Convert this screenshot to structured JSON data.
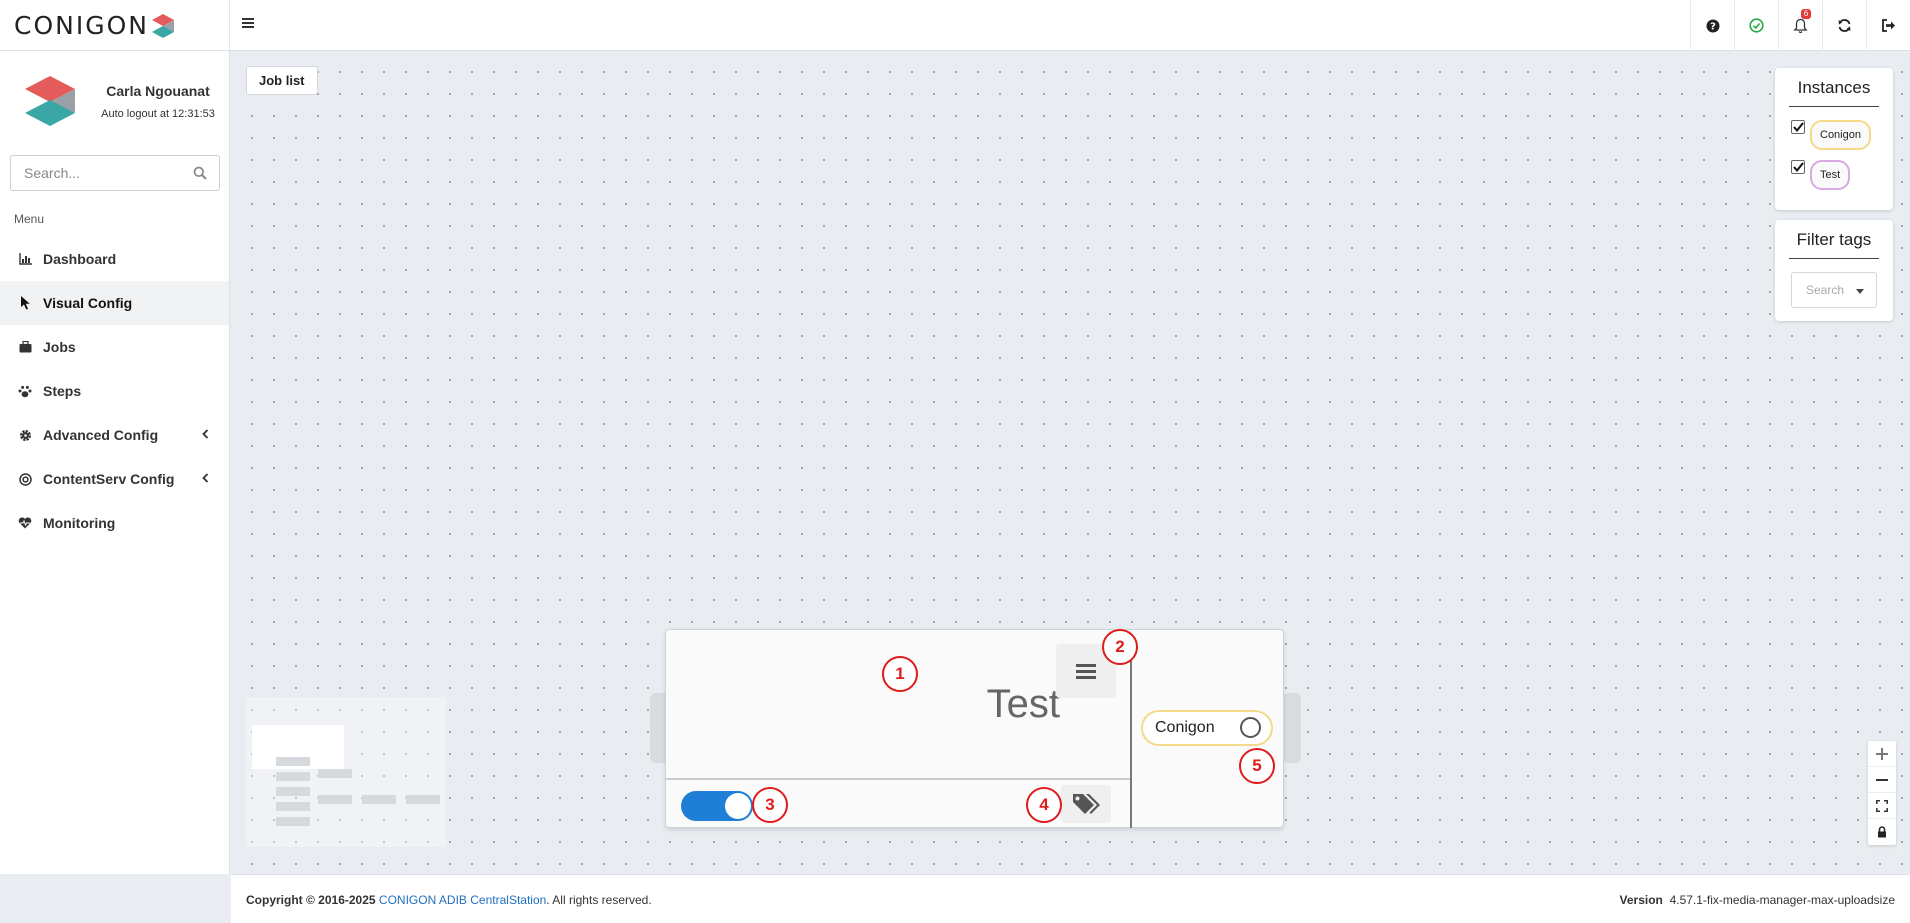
{
  "header": {
    "logo_text": "CONIGON",
    "icons": [
      "menu-icon",
      "help-icon",
      "status-ok-icon",
      "bell-icon",
      "refresh-icon",
      "logout-icon"
    ],
    "notification_count": "6"
  },
  "sidebar": {
    "user_name": "Carla Ngouanat",
    "auto_logout": "Auto logout at 12:31:53",
    "search_placeholder": "Search...",
    "menu_label": "Menu",
    "items": [
      {
        "label": "Dashboard",
        "icon": "chart-icon"
      },
      {
        "label": "Visual Config",
        "icon": "pointer-icon",
        "active": true
      },
      {
        "label": "Jobs",
        "icon": "briefcase-icon"
      },
      {
        "label": "Steps",
        "icon": "paw-icon"
      },
      {
        "label": "Advanced Config",
        "icon": "gear-icon"
      },
      {
        "label": "ContentServ Config",
        "icon": "target-icon"
      },
      {
        "label": "Monitoring",
        "icon": "heartbeat-icon"
      }
    ]
  },
  "canvas": {
    "job_list_button": "Job list",
    "instances_panel": {
      "title": "Instances",
      "items": [
        {
          "label": "Conigon",
          "checked": true,
          "color": "#f5d889"
        },
        {
          "label": "Test",
          "checked": true,
          "color": "#d8a9e3"
        }
      ]
    },
    "filter_tags_panel": {
      "title": "Filter tags",
      "select_placeholder": "Search"
    },
    "job_node": {
      "title": "Test",
      "enabled": true,
      "instance_label": "Conigon",
      "toggle_color": "#1f7fd6"
    },
    "markers": [
      "1",
      "2",
      "3",
      "4",
      "5"
    ],
    "zoom_controls": [
      "+",
      "−",
      "fit",
      "lock"
    ]
  },
  "footer": {
    "copyright_prefix": "Copyright © 2016-2025",
    "company_link": "CONIGON ADIB CentralStation",
    "copyright_suffix": ". All rights reserved.",
    "version_label": "Version",
    "version_value": "4.57.1-fix-media-manager-max-uploadsize"
  }
}
